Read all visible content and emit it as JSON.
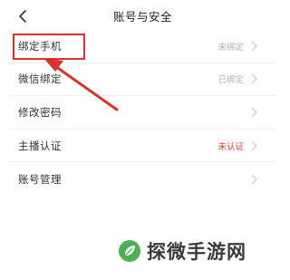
{
  "header": {
    "title": "账号与安全"
  },
  "rows": [
    {
      "label": "绑定手机",
      "status": "未绑定",
      "status_color": "#b0b0b0"
    },
    {
      "label": "微信绑定",
      "status": "已绑定",
      "status_color": "#b0b0b0"
    },
    {
      "label": "修改密码",
      "status": "",
      "status_color": "#b0b0b0"
    },
    {
      "label": "主播认证",
      "status": "未认证",
      "status_color": "#e8372f"
    },
    {
      "label": "账号管理",
      "status": "",
      "status_color": "#b0b0b0"
    }
  ],
  "annotation": {
    "highlight_color": "#d9342b"
  },
  "watermark": {
    "text": "探微手游网",
    "logo_color": "#4caf50"
  }
}
